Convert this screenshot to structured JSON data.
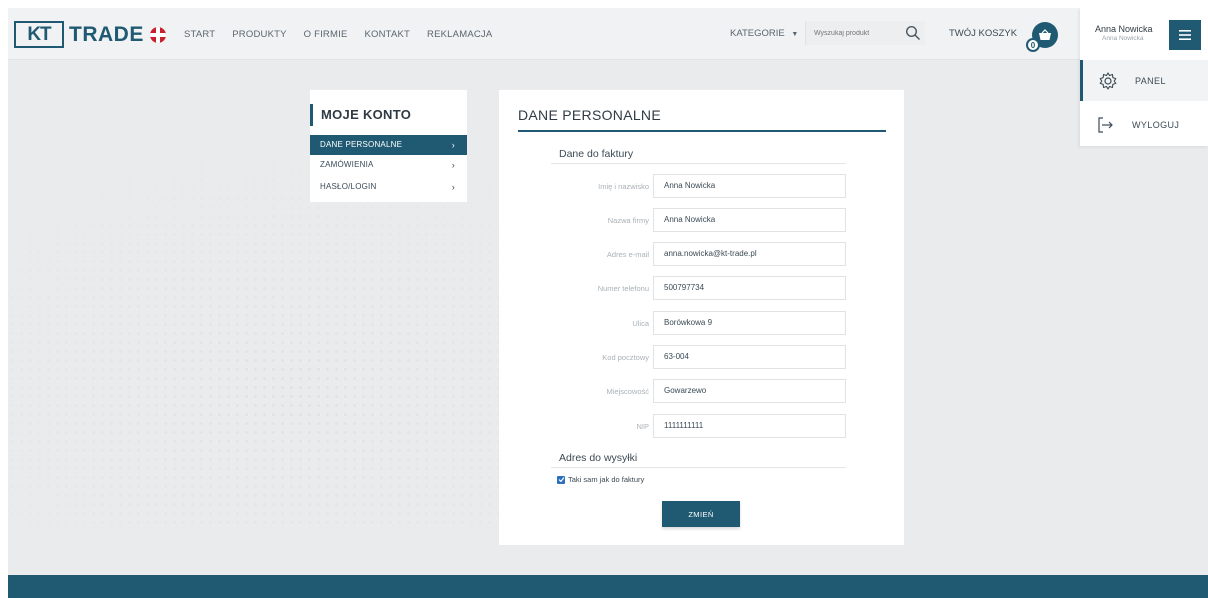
{
  "header": {
    "logo_box": "KT",
    "logo_text": "TRADE",
    "nav": [
      "START",
      "PRODUKTY",
      "O FIRMIE",
      "KONTAKT",
      "REKLAMACJA"
    ],
    "kategorie": "KATEGORIE",
    "search_placeholder": "Wyszukaj produkt",
    "cart_label": "TWÓJ KOSZYK",
    "cart_count": "0"
  },
  "user": {
    "name": "Anna Nowicka",
    "sub": "Anna Nowicka",
    "menu": [
      {
        "label": "PANEL",
        "icon": "gear-icon"
      },
      {
        "label": "WYLOGUJ",
        "icon": "logout-icon"
      }
    ]
  },
  "account": {
    "title": "MOJE KONTO",
    "items": [
      "DANE PERSONALNE",
      "ZAMÓWIENIA",
      "HASŁO/LOGIN"
    ]
  },
  "form": {
    "title": "DANE PERSONALNE",
    "invoice_section": "Dane do faktury",
    "fields": [
      {
        "label": "Imię i nazwisko",
        "value": "Anna Nowicka"
      },
      {
        "label": "Nazwa firmy",
        "value": "Anna Nowicka"
      },
      {
        "label": "Adres e-mail",
        "value": "anna.nowicka@kt-trade.pl"
      },
      {
        "label": "Numer telefonu",
        "value": "500797734"
      },
      {
        "label": "Ulica",
        "value": "Borówkowa 9"
      },
      {
        "label": "Kod pocztowy",
        "value": "63-004"
      },
      {
        "label": "Miejscowość",
        "value": "Gowarzewo"
      },
      {
        "label": "NIP",
        "value": "1111111111"
      }
    ],
    "shipping_section": "Adres do wysyłki",
    "same_as_invoice": "Taki sam jak do faktury",
    "same_as_invoice_checked": true,
    "submit": "ZMIEŃ"
  },
  "colors": {
    "accent": "#1f5a72",
    "background": "#e9ebec",
    "checkbox": "#2b6fbf"
  }
}
